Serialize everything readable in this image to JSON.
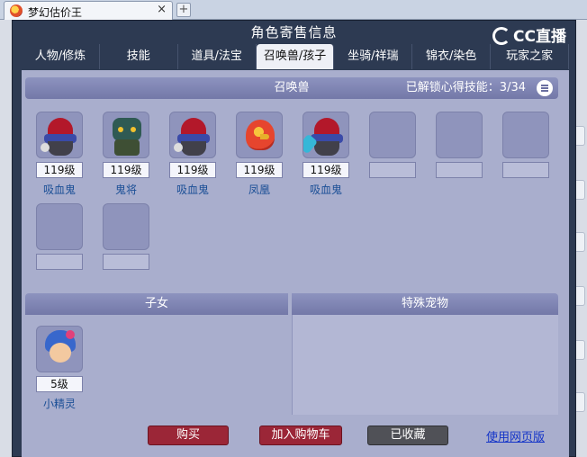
{
  "browser": {
    "tab_title": "梦幻估价王",
    "close_glyph": "×",
    "new_tab_glyph": "+"
  },
  "dialog": {
    "title": "角色寄售信息",
    "logo_text": "CC直播"
  },
  "nav": {
    "tabs": [
      {
        "label": "人物/修炼"
      },
      {
        "label": "技能"
      },
      {
        "label": "道具/法宝"
      },
      {
        "label": "召唤兽/孩子",
        "active": true
      },
      {
        "label": "坐骑/祥瑞"
      },
      {
        "label": "锦衣/染色"
      },
      {
        "label": "玩家之家"
      }
    ]
  },
  "pets_section": {
    "title": "召唤兽",
    "skills_unlocked": "已解锁心得技能：3/34",
    "pets": [
      {
        "level": "119级",
        "name": "吸血鬼",
        "icon": "vampire-icon"
      },
      {
        "level": "119级",
        "name": "鬼将",
        "icon": "ghost-general-icon"
      },
      {
        "level": "119级",
        "name": "吸血鬼",
        "icon": "vampire-icon"
      },
      {
        "level": "119级",
        "name": "凤凰",
        "icon": "phoenix-icon"
      },
      {
        "level": "119级",
        "name": "吸血鬼",
        "icon": "vampire-icon"
      }
    ],
    "empty_slots": 5
  },
  "children_section": {
    "title": "子女",
    "children": [
      {
        "level": "5级",
        "name": "小精灵",
        "icon": "sprite-icon"
      }
    ]
  },
  "special_section": {
    "title": "特殊宠物"
  },
  "footer": {
    "buy": "购买",
    "add_to_cart": "加入购物车",
    "favorited": "已收藏",
    "web_version": "使用网页版"
  },
  "colors": {
    "dialog_bg": "#2d3a52",
    "panel_bg": "#a9aecd",
    "buy_red": "#9b2637",
    "favorited_gray": "#505157",
    "name_blue": "#1b4f96"
  }
}
